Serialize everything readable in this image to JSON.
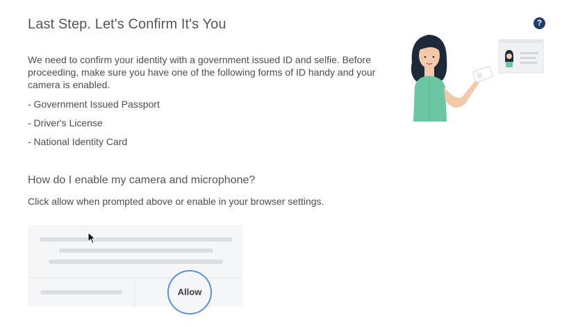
{
  "header": {
    "title": "Last Step. Let's Confirm It's You",
    "help_icon": "question-circle-icon",
    "help_symbol": "?"
  },
  "intro": {
    "text": "We need to confirm your identity with a government issued ID and selfie. Before proceeding, make sure you have one of the following forms of ID handy and your camera is enabled."
  },
  "id_forms": [
    "- Government Issued Passport",
    "- Driver's License",
    "- National Identity Card"
  ],
  "camera_help": {
    "heading": "How do I enable my camera and microphone?",
    "hint": "Click allow when prompted above or enable in your browser settings.",
    "allow_label": "Allow"
  },
  "colors": {
    "help_badge": "#1f3c6e",
    "allow_ring": "#5b8fd9",
    "shirt": "#6cc6a4",
    "hair": "#1e2a3a"
  }
}
